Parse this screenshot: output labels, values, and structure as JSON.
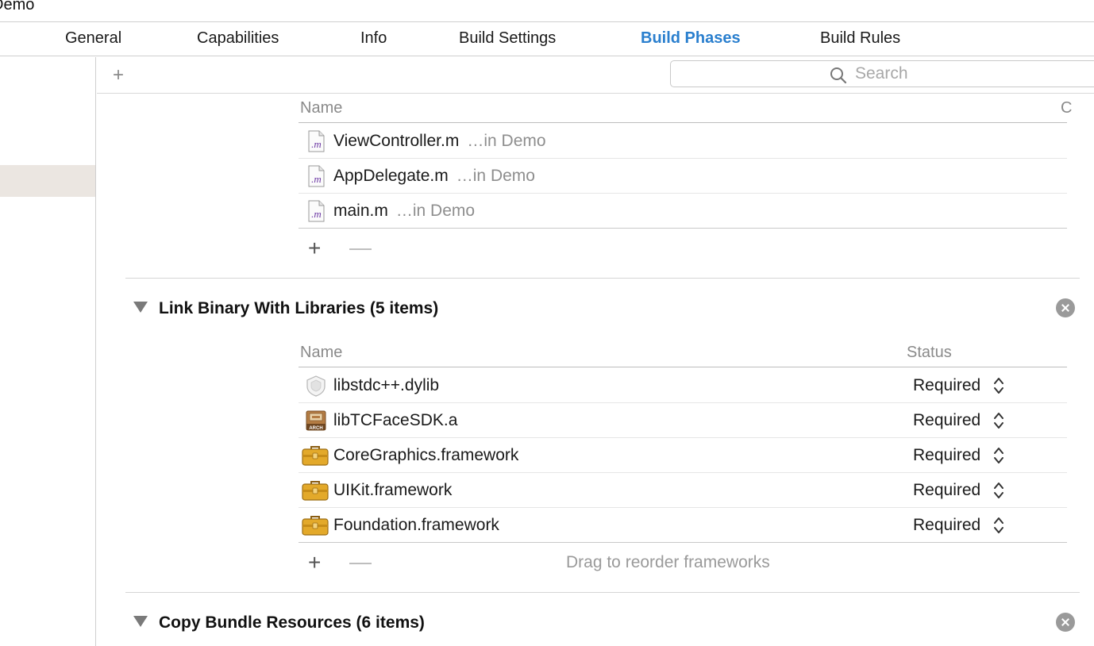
{
  "window": {
    "title_fragment": "Demo"
  },
  "tabs": [
    {
      "label": "General",
      "active": false
    },
    {
      "label": "Capabilities",
      "active": false
    },
    {
      "label": "Info",
      "active": false
    },
    {
      "label": "Build Settings",
      "active": false
    },
    {
      "label": "Build Phases",
      "active": true
    },
    {
      "label": "Build Rules",
      "active": false
    }
  ],
  "toolbar": {
    "add_label": "+"
  },
  "search": {
    "placeholder": "Search",
    "icon": "search-icon"
  },
  "compile_sources": {
    "column_name": "Name",
    "column_status_partial": "C",
    "files": [
      {
        "name": "ViewController.m",
        "location": "…in Demo",
        "icon": "objc-m-file-icon"
      },
      {
        "name": "AppDelegate.m",
        "location": "…in Demo",
        "icon": "objc-m-file-icon"
      },
      {
        "name": "main.m",
        "location": "…in Demo",
        "icon": "objc-m-file-icon"
      }
    ],
    "add_label": "+",
    "remove_label": "—"
  },
  "link_binary": {
    "title": "Link Binary With Libraries (5 items)",
    "column_name": "Name",
    "column_status": "Status",
    "libraries": [
      {
        "name": "libstdc++.dylib",
        "status": "Required",
        "icon": "dylib-icon"
      },
      {
        "name": "libTCFaceSDK.a",
        "status": "Required",
        "icon": "static-archive-icon"
      },
      {
        "name": "CoreGraphics.framework",
        "status": "Required",
        "icon": "framework-toolbox-icon"
      },
      {
        "name": "UIKit.framework",
        "status": "Required",
        "icon": "framework-toolbox-icon"
      },
      {
        "name": "Foundation.framework",
        "status": "Required",
        "icon": "framework-toolbox-icon"
      }
    ],
    "add_label": "+",
    "remove_label": "—",
    "drag_hint": "Drag to reorder frameworks"
  },
  "copy_bundle": {
    "title": "Copy Bundle Resources (6 items)"
  },
  "colors": {
    "accent_tab": "#2a7fce",
    "framework_icon": "#e3a92a",
    "archive_icon": "#a5703a",
    "m_file_letter": "#6e3aa5"
  }
}
